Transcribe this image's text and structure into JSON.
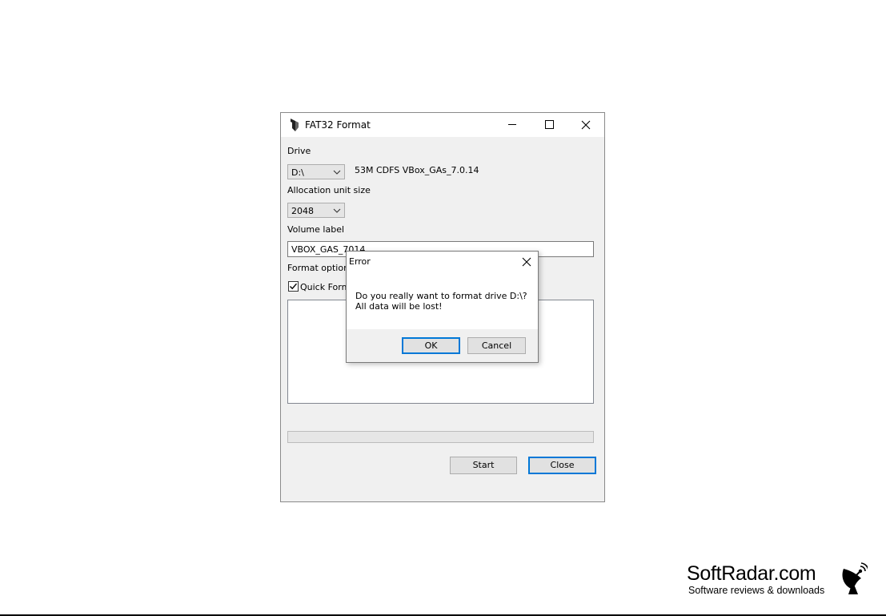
{
  "window": {
    "title": "FAT32 Format",
    "icon": "fat32-format-app-icon",
    "controls": {
      "minimize": "minimize-icon",
      "maximize": "maximize-icon",
      "close": "close-icon"
    }
  },
  "drive": {
    "label": "Drive",
    "selected": "D:\\",
    "info": "53M CDFS VBox_GAs_7.0.14"
  },
  "allocation": {
    "label": "Allocation unit size",
    "selected": "2048"
  },
  "volume": {
    "label": "Volume label",
    "value": "VBOX_GAS_7014"
  },
  "format_options": {
    "label": "Format options",
    "quick_format_label": "Quick Format",
    "quick_format_checked": true
  },
  "progress": {
    "fraction": 0.0
  },
  "buttons": {
    "start": "Start",
    "close": "Close"
  },
  "dialog": {
    "title": "Error",
    "message_line1": "Do you really want to format drive D:\\?",
    "message_line2": "All data will be lost!",
    "ok": "OK",
    "cancel": "Cancel"
  },
  "watermark": {
    "name": "SoftRadar.com",
    "tagline": "Software reviews & downloads"
  },
  "colors": {
    "accent": "#0078d7",
    "window_bg": "#f0f0f0",
    "titlebar_bg": "#ffffff"
  }
}
